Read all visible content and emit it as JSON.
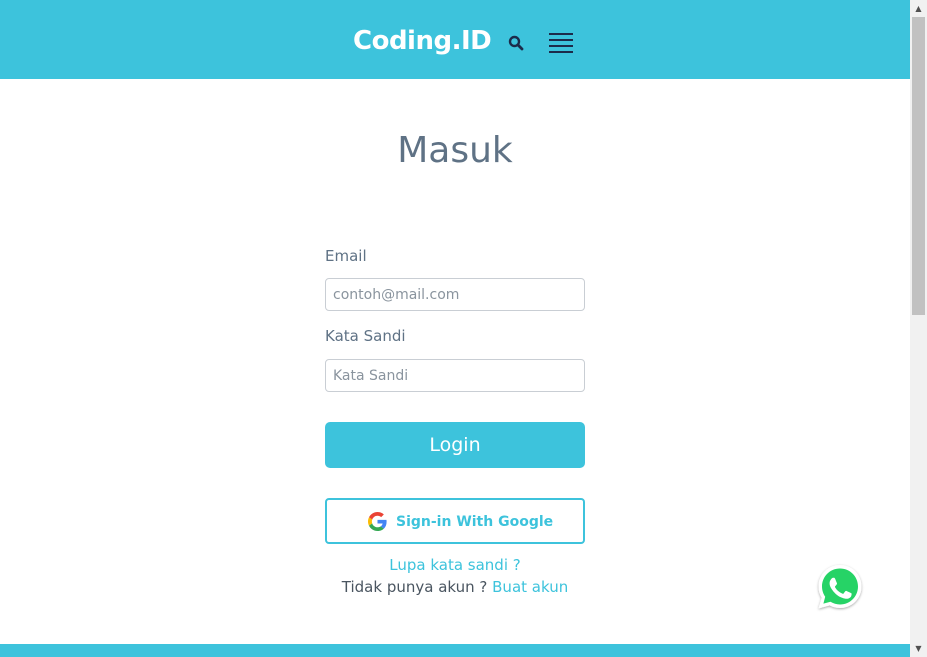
{
  "header": {
    "logo_text": "Coding.ID",
    "search_icon": "search-icon",
    "menu_icon": "hamburger-menu-icon",
    "background_color": "#3dc3dc"
  },
  "login": {
    "title": "Masuk",
    "email_label": "Email",
    "email_placeholder": "contoh@mail.com",
    "email_value": "",
    "password_label": "Kata Sandi",
    "password_placeholder": "Kata Sandi",
    "password_value": "",
    "login_button": "Login",
    "google_button": "Sign-in With Google",
    "google_icon": "google-g-icon",
    "forgot_password": "Lupa kata sandi ?",
    "no_account_text": "Tidak punya akun ?",
    "signup_link": "Buat akun"
  },
  "floating": {
    "whatsapp_icon": "whatsapp-icon",
    "whatsapp_color": "#25d366"
  },
  "theme": {
    "accent": "#3dc3dc",
    "title_color": "#5f7285",
    "text_color": "#4a5560"
  }
}
